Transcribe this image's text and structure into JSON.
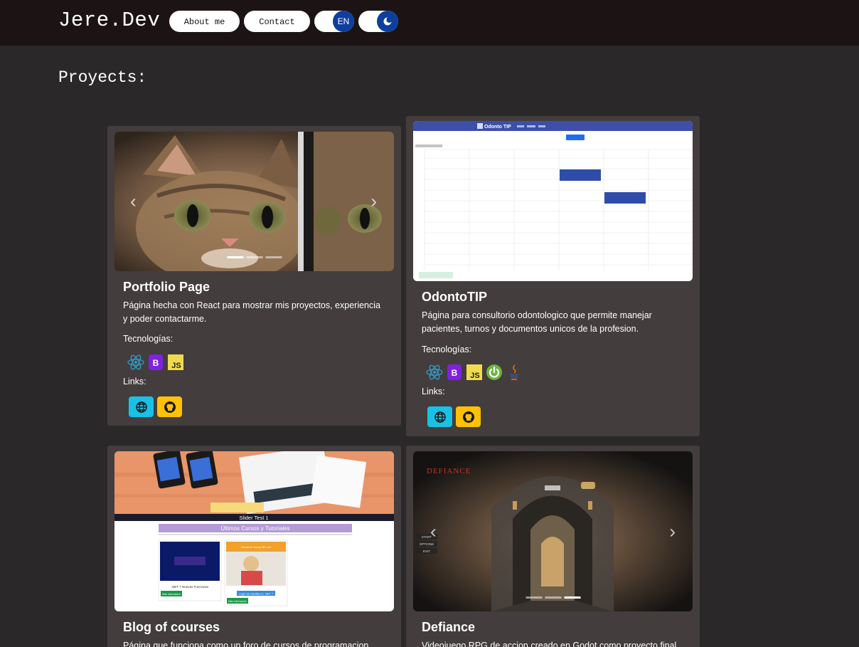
{
  "nav": {
    "brand": "Jere.Dev",
    "about": "About me",
    "contact": "Contact",
    "lang": "EN"
  },
  "section_title": "Proyects:",
  "labels": {
    "tech": "Tecnologías:",
    "links": "Links:"
  },
  "projects": [
    {
      "title": "Portfolio Page",
      "desc": "Página hecha con React para mostrar mis proyectos, experiencia y poder contactarme.",
      "tech": [
        "react-icon",
        "bootstrap-icon",
        "javascript-icon"
      ]
    },
    {
      "title": "OdontoTIP",
      "desc": "Página para consultorio odontologico que permite manejar pacientes, turnos y documentos unicos de la profesion.",
      "tech": [
        "react-icon",
        "bootstrap-icon",
        "javascript-icon",
        "spring-icon",
        "java-icon"
      ],
      "screenshot_header": "Odonto TIP"
    },
    {
      "title": "Blog of courses",
      "desc": "Página que funciona como un foro de cursos de programacion",
      "screenshot": {
        "slider": "Slider Test 1",
        "heading": "Últimos Cursos y Tutoriales",
        "course1": ".NET 7 Nuevas Funciones",
        "course2": "Login de Identity en .NET 7",
        "more": "Más Información",
        "banner": "Nuestros cursos $9 usd"
      }
    },
    {
      "title": "Defiance",
      "desc": "Videojuego RPG de accion creado en Godot como proyecto final",
      "screenshot": {
        "logo": "DEFIANCE",
        "menu": [
          "START",
          "OPTIONS",
          "EXIT"
        ]
      }
    }
  ],
  "colors": {
    "background": "#2a2828",
    "navbar": "#1c1414",
    "card": "#433d3d",
    "toggle_knob": "#0d3f9e",
    "web_button": "#17c2e6",
    "github_button": "#ffc107"
  }
}
